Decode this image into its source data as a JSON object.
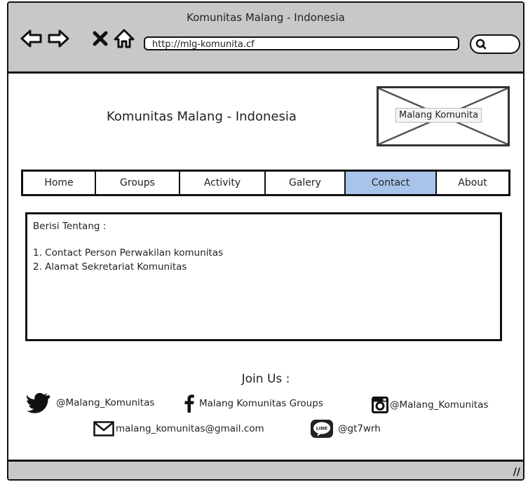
{
  "browser": {
    "window_title": "Komunitas Malang - Indonesia",
    "url": "http://mlg-komunita.cf"
  },
  "header": {
    "site_title": "Komunitas Malang - Indonesia",
    "logo_label": "Malang Komunita"
  },
  "nav": {
    "tabs": [
      {
        "label": "Home"
      },
      {
        "label": "Groups"
      },
      {
        "label": "Activity"
      },
      {
        "label": "Galery"
      },
      {
        "label": "Contact"
      },
      {
        "label": "About"
      }
    ],
    "active": "Contact"
  },
  "content": {
    "heading": "Berisi Tentang :",
    "items": [
      "1. Contact Person Perwakilan komunitas",
      "2. Alamat Sekretariat Komunitas"
    ]
  },
  "footer": {
    "join_label": "Join Us :",
    "twitter": "@Malang_Komunitas",
    "facebook": "Malang Komunitas Groups",
    "instagram": "@Malang_Komunitas",
    "email": "malang_komunitas@gmail.com",
    "line": "@gt7wrh"
  },
  "colors": {
    "chrome": "#c8c8c8",
    "active_tab": "#a9c4eb"
  }
}
